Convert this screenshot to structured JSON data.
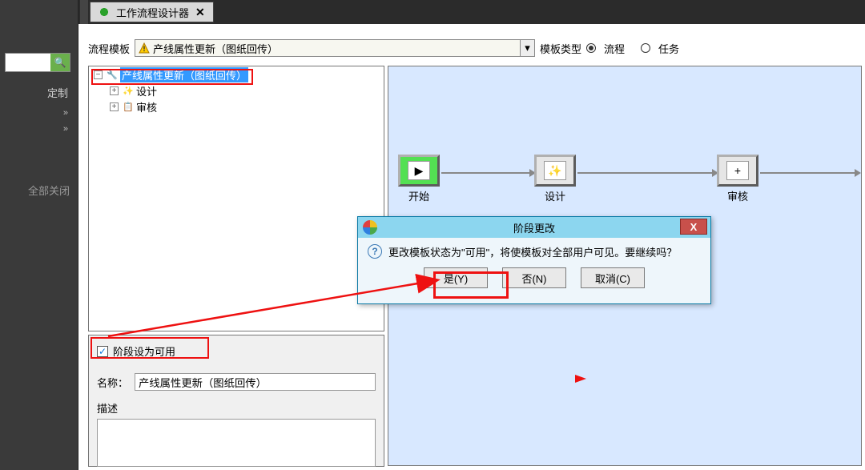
{
  "tab": {
    "title": "工作流程设计器",
    "close": "✕"
  },
  "sidebar": {
    "customize": "定制",
    "close_all": "全部关闭"
  },
  "toolbar": {
    "template_label": "流程模板",
    "template_value": "产线属性更新（图纸回传）",
    "type_label": "模板类型",
    "opt_flow": "流程",
    "opt_task": "任务"
  },
  "tree": {
    "root": "产线属性更新（图纸回传）",
    "child1": "设计",
    "child2": "审核"
  },
  "canvas": {
    "start": "开始",
    "design": "设计",
    "review": "审核"
  },
  "prop": {
    "stage_enable": "阶段设为可用",
    "name_label": "名称：",
    "name_value": "产线属性更新（图纸回传）",
    "desc_label": "描述"
  },
  "dialog": {
    "title": "阶段更改",
    "message": "更改模板状态为\"可用\"，将使模板对全部用户可见。要继续吗？",
    "yes": "是(Y)",
    "no": "否(N)",
    "cancel": "取消(C)"
  }
}
